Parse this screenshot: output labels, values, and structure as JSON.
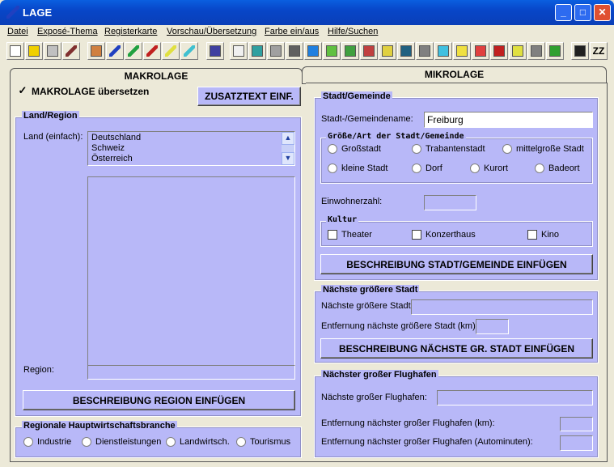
{
  "window": {
    "title": "LAGE",
    "minimize": "_",
    "maximize": "□",
    "close": "✕"
  },
  "menu": [
    "Datei",
    "Exposé-Thema",
    "Registerkarte",
    "Vorschau/Übersetzung",
    "Farbe ein/aus",
    "Hilfe/Suchen"
  ],
  "toolbar": {
    "icons": [
      {
        "name": "new-document-icon",
        "color": "#ffffff"
      },
      {
        "name": "open-folder-icon",
        "color": "#f0d000"
      },
      {
        "name": "save-icon",
        "color": "#c0c0c0"
      },
      {
        "name": "pen-brown-icon",
        "color": "#803030"
      },
      {
        "name": "house-icon",
        "color": "#d08040"
      },
      {
        "name": "pen-blue-icon",
        "color": "#2040c0"
      },
      {
        "name": "pen-green-icon",
        "color": "#20a040"
      },
      {
        "name": "pen-red-icon",
        "color": "#c02020"
      },
      {
        "name": "pen-yellow-icon",
        "color": "#e0e040"
      },
      {
        "name": "pen-cyan-icon",
        "color": "#40c0d0"
      },
      {
        "name": "uk-flag-icon",
        "color": "#4040a0"
      },
      {
        "name": "document-pen-icon",
        "color": "#f0f0f0"
      },
      {
        "name": "money-bag-icon",
        "color": "#30a0a0"
      },
      {
        "name": "globe-grid-icon",
        "color": "#a0a0a0"
      },
      {
        "name": "key-icon",
        "color": "#606060"
      },
      {
        "name": "globe-icon",
        "color": "#2080e0"
      },
      {
        "name": "building-green-icon",
        "color": "#60c040"
      },
      {
        "name": "landscape-icon",
        "color": "#40a040"
      },
      {
        "name": "houses-icon",
        "color": "#c04040"
      },
      {
        "name": "door-icon",
        "color": "#e0d040"
      },
      {
        "name": "factory-icon",
        "color": "#206080"
      },
      {
        "name": "office-icon",
        "color": "#808080"
      },
      {
        "name": "list-icon",
        "color": "#40c0e0"
      },
      {
        "name": "home-face-icon",
        "color": "#f0e040"
      },
      {
        "name": "dimensions-icon",
        "color": "#e04040"
      },
      {
        "name": "bricks-icon",
        "color": "#c02020"
      },
      {
        "name": "window-icon",
        "color": "#e0e040"
      },
      {
        "name": "wrench-icon",
        "color": "#808080"
      },
      {
        "name": "garden-icon",
        "color": "#30a030"
      },
      {
        "name": "color-toggle-icon",
        "color": "#202020"
      },
      {
        "name": "zz-icon",
        "color": "#ece9d8",
        "text": "ZZ"
      }
    ]
  },
  "tabs": {
    "makro": "MAKROLAGE",
    "mikro": "MIKROLAGE"
  },
  "makro": {
    "translate_label": "MAKROLAGE übersetzen",
    "translate_checked": "✓",
    "zusatz_button": "ZUSATZTEXT EINF.",
    "land_region": {
      "title": "Land/Region",
      "land_label": "Land (einfach):",
      "countries": [
        "Deutschland",
        "Schweiz",
        "Österreich"
      ],
      "region_label": "Region:",
      "region_value": "",
      "button": "BESCHREIBUNG REGION EINFÜGEN"
    },
    "branche": {
      "title": "Regionale Hauptwirtschaftsbranche",
      "options": [
        "Industrie",
        "Dienstleistungen",
        "Landwirtsch.",
        "Tourismus"
      ]
    }
  },
  "mikro": {
    "stadt": {
      "title": "Stadt/Gemeinde",
      "name_label": "Stadt-/Gemeindename:",
      "name_value": "Freiburg",
      "groesse_title": "Größe/Art der Stadt/Gemeinde",
      "groesse_options": [
        "Großstadt",
        "Trabantenstadt",
        "mittelgroße Stadt",
        "kleine Stadt",
        "Dorf",
        "Kurort",
        "Badeort"
      ],
      "einwohner_label": "Einwohnerzahl:",
      "einwohner_value": "",
      "kultur_title": "Kultur",
      "kultur_options": [
        "Theater",
        "Konzerthaus",
        "Kino"
      ],
      "button": "BESCHREIBUNG STADT/GEMEINDE EINFÜGEN"
    },
    "naechste_stadt": {
      "title": "Nächste größere Stadt",
      "stadt_label": "Nächste größere Stadt:",
      "entfernung_label": "Entfernung nächste größere Stadt (km):",
      "button": "BESCHREIBUNG NÄCHSTE GR. STADT EINFÜGEN"
    },
    "flughafen": {
      "title": "Nächster großer Flughafen",
      "name_label": "Nächste großer Flughafen:",
      "km_label": "Entfernung nächster großer Flughafen (km):",
      "min_label": "Entfernung nächster großer Flughafen (Autominuten):"
    }
  }
}
